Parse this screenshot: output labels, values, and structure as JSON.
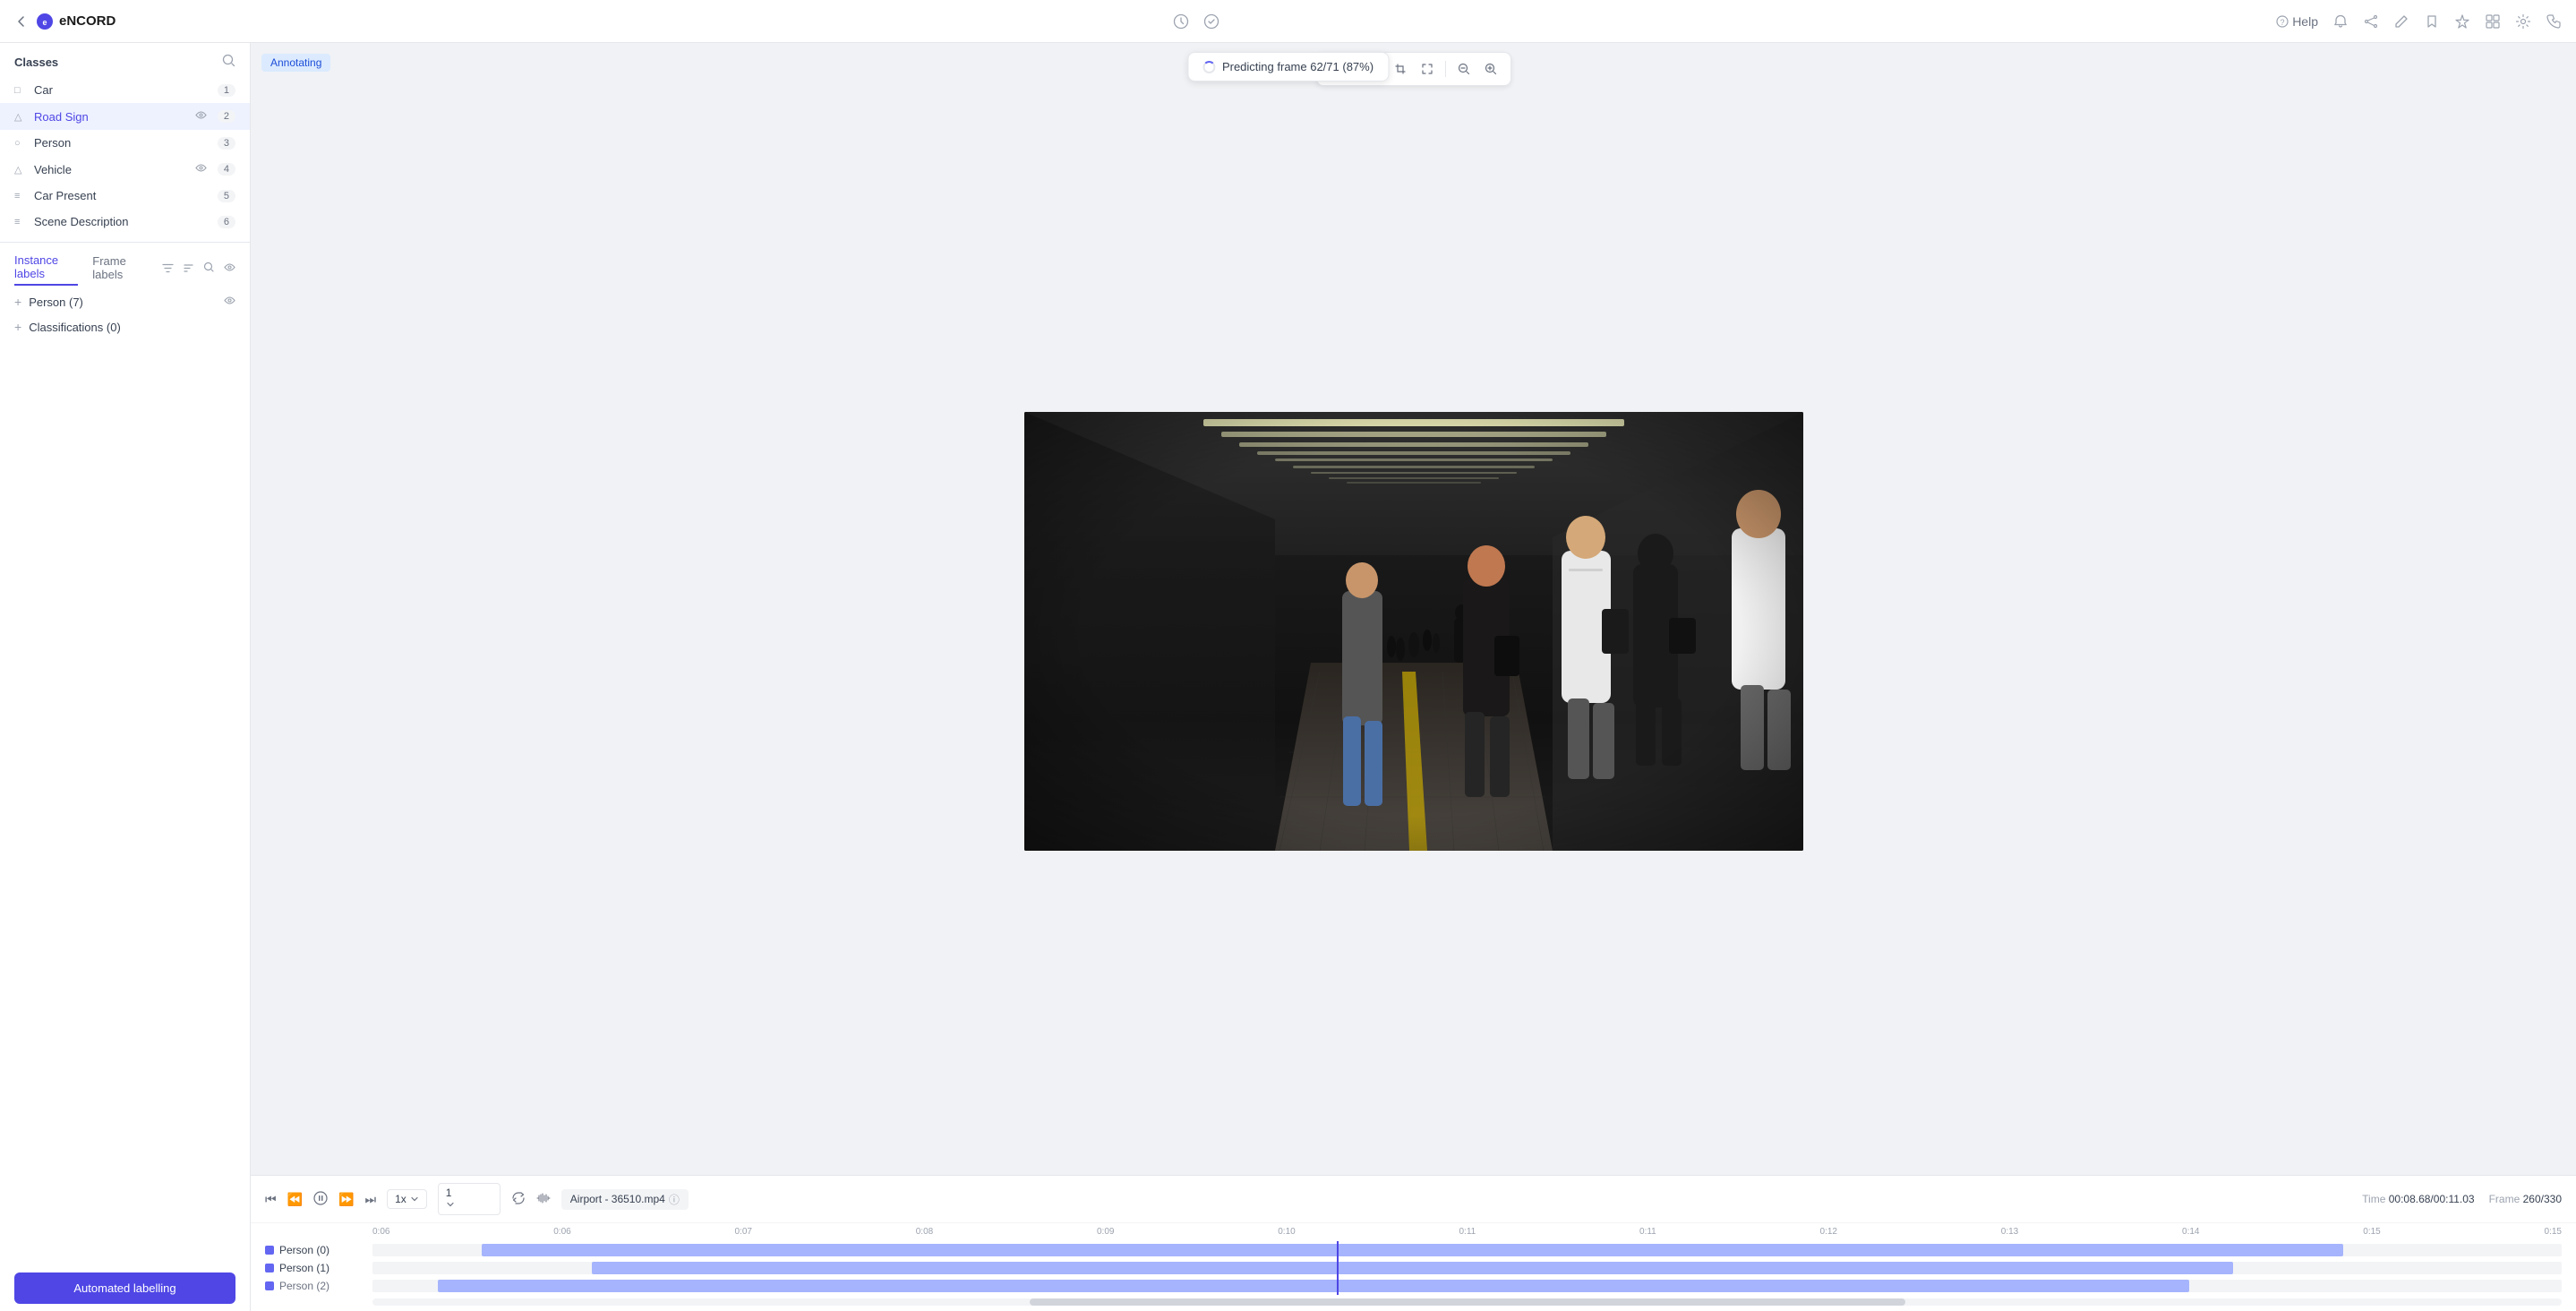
{
  "app": {
    "logo_text": "eNCORD",
    "back_icon": "←"
  },
  "header": {
    "help_label": "Help",
    "icons": [
      "clock-icon",
      "clock-check-icon",
      "bell-icon",
      "share-icon",
      "pen-icon",
      "bookmark-icon",
      "star-icon",
      "grid-icon",
      "settings-icon",
      "phone-icon"
    ]
  },
  "predicting_toast": {
    "text": "Predicting frame 62/71 (87%)"
  },
  "annotating_badge": "Annotating",
  "sidebar": {
    "classes_title": "Classes",
    "search_placeholder": "Search classes",
    "classes": [
      {
        "name": "Car",
        "icon": "□",
        "badge": "1",
        "has_visibility": false
      },
      {
        "name": "Road Sign",
        "icon": "△",
        "badge": "2",
        "has_visibility": true
      },
      {
        "name": "Person",
        "icon": "○",
        "badge": "3",
        "has_visibility": false
      },
      {
        "name": "Vehicle",
        "icon": "△",
        "badge": "4",
        "has_visibility": true
      },
      {
        "name": "Car Present",
        "icon": "≡",
        "badge": "5",
        "has_visibility": false
      },
      {
        "name": "Scene Description",
        "icon": "≡",
        "badge": "6",
        "has_visibility": false
      }
    ],
    "tabs": {
      "instance_label": "Instance labels",
      "frame_label": "Frame labels"
    },
    "tab_actions": [
      "filter-icon",
      "sort-icon",
      "search-icon",
      "eye-icon"
    ],
    "instances": [
      {
        "label": "Person (7)",
        "has_eye": true
      },
      {
        "label": "Classifications (0)",
        "has_eye": false
      }
    ],
    "automated_label_btn": "Automated labelling"
  },
  "toolbar": {
    "buttons": [
      "cursor-icon",
      "plus-icon",
      "crop-icon",
      "expand-icon",
      "zoom-out-icon",
      "zoom-in-icon"
    ]
  },
  "playback": {
    "speed": "1x",
    "frame_value": "1",
    "filename": "Airport - 36510.mp4",
    "time_label": "Time",
    "time_value": "00:08.68/00:11.03",
    "frame_label": "Frame",
    "frame_display": "260/330"
  },
  "timeline": {
    "timestamps": [
      "0:06",
      "0:06",
      "0:07",
      "0:08",
      "0:09",
      "0:10",
      "0:11",
      "0:11",
      "0:12",
      "0:13",
      "0:14",
      "0:15",
      "0:15"
    ],
    "tracks": [
      {
        "label": "Person (0)",
        "color": "#6366f1"
      },
      {
        "label": "Person (1)",
        "color": "#6366f1"
      },
      {
        "label": "Person (2)",
        "color": "#6366f1"
      }
    ],
    "playhead_pct": 42
  }
}
